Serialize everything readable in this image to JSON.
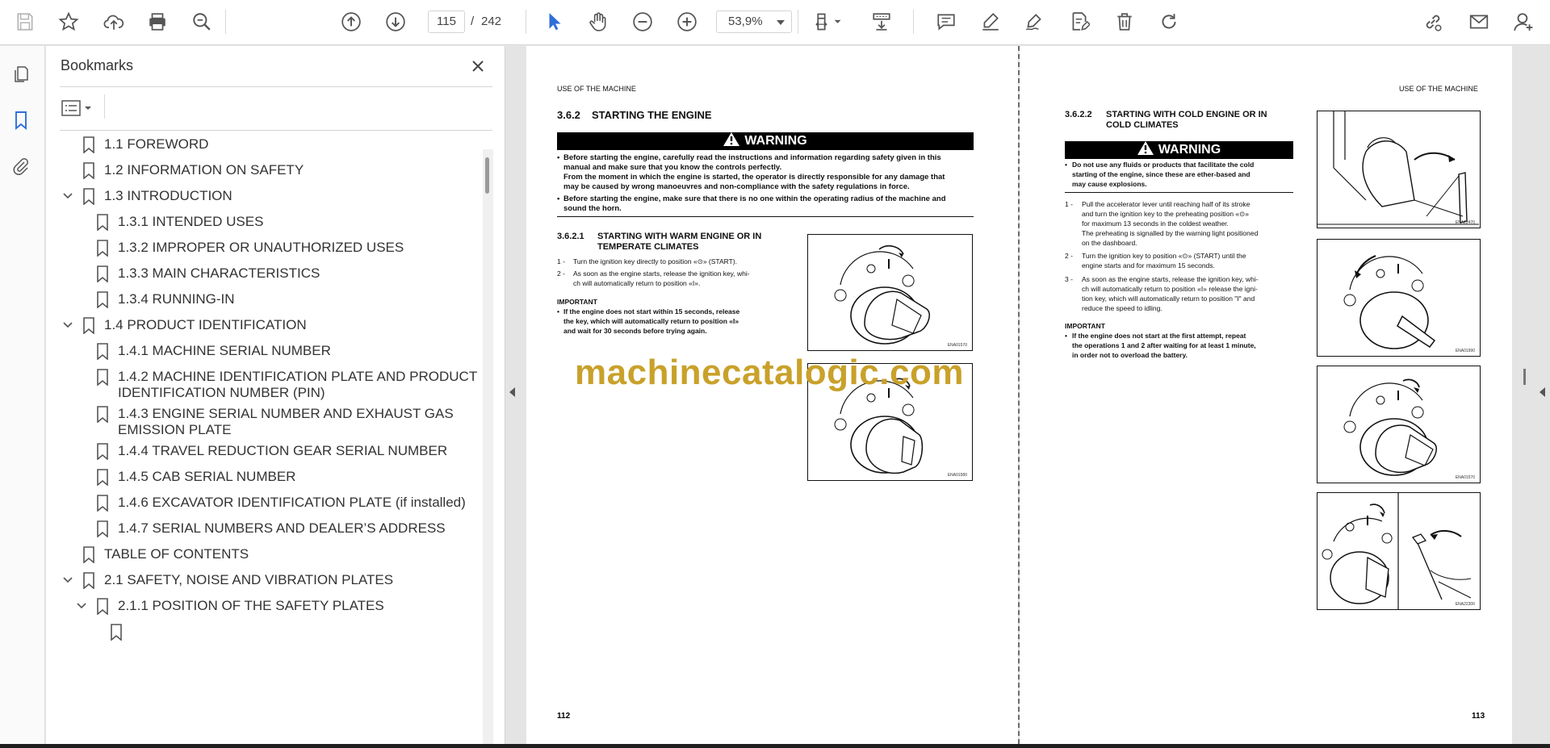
{
  "toolbar": {
    "icons": [
      "save-icon",
      "bookmark-star-icon",
      "upload-icon",
      "print-icon",
      "search-zoom-icon",
      "page-up-icon",
      "page-down-icon",
      "select-cursor-icon",
      "hand-icon",
      "zoom-out-icon",
      "zoom-in-icon",
      "fit-page-icon",
      "scroll-mode-icon",
      "comment-icon",
      "highlight-icon",
      "sign-icon",
      "edit-pdf-icon",
      "delete-icon",
      "rotate-icon",
      "share-link-icon",
      "email-icon",
      "account-icon"
    ],
    "page_current": "115",
    "page_separator": "/",
    "page_total": "242",
    "zoom_value": "53,9%"
  },
  "bookmarks": {
    "title": "Bookmarks",
    "items": [
      {
        "label": "1.1 FOREWORD"
      },
      {
        "label": "1.2 INFORMATION ON SAFETY"
      },
      {
        "label": "1.3 INTRODUCTION"
      },
      {
        "label": "1.3.1 INTENDED USES"
      },
      {
        "label": "1.3.2 IMPROPER OR UNAUTHORIZED USES"
      },
      {
        "label": "1.3.3 MAIN CHARACTERISTICS"
      },
      {
        "label": "1.3.4 RUNNING-IN"
      },
      {
        "label": "1.4 PRODUCT IDENTIFICATION"
      },
      {
        "label": "1.4.1 MACHINE SERIAL NUMBER"
      },
      {
        "label": "1.4.2 MACHINE IDENTIFICATION PLATE AND PRODUCT",
        "label2": "IDENTIFICATION NUMBER (PIN)"
      },
      {
        "label": "1.4.3 ENGINE SERIAL NUMBER AND EXHAUST GAS",
        "label2": "EMISSION PLATE"
      },
      {
        "label": "1.4.4 TRAVEL REDUCTION GEAR SERIAL NUMBER"
      },
      {
        "label": "1.4.5 CAB SERIAL NUMBER"
      },
      {
        "label": "1.4.6 EXCAVATOR IDENTIFICATION PLATE (if installed)"
      },
      {
        "label": "1.4.7 SERIAL NUMBERS AND DEALER’S ADDRESS"
      },
      {
        "label": "TABLE OF CONTENTS"
      },
      {
        "label": "2.1 SAFETY, NOISE AND VIBRATION PLATES"
      },
      {
        "label": "2.1.1 POSITION OF THE SAFETY PLATES"
      }
    ]
  },
  "left_page": {
    "header": "USE OF THE MACHINE",
    "section_num": "3.6.2",
    "section_title": "STARTING THE ENGINE",
    "warning": "WARNING",
    "w1a": "Before starting the engine, carefully read the instructions and information regarding safety given in this",
    "w1b": "manual and make sure that you know the controls perfectly.",
    "w1c": "From the moment in which the engine is started, the operator is directly responsible for any damage that",
    "w1d": "may be caused by wrong manoeuvres and non-compliance with the safety regulations in force.",
    "w2a": "Before starting the engine, make sure that there is no one within the operating radius of the machine and",
    "w2b": "sound the horn.",
    "sub_num": "3.6.2.1",
    "sub_title_a": "STARTING WITH WARM ENGINE OR IN",
    "sub_title_b": "TEMPERATE CLIMATES",
    "s1_num": "1 -",
    "s1": "Turn the ignition key directly to position «⊙» (START).",
    "s2_num": "2 -",
    "s2a": "As soon as the engine starts, release the ignition key, whi-",
    "s2b": "ch will automatically return to position «I».",
    "important": "IMPORTANT",
    "imp_a": "If the engine does not start within 15 seconds, release",
    "imp_b": "the key, which will automatically return to position «I»",
    "imp_c": "and wait for 30 seconds before trying again.",
    "fig1_code": "ENA01570",
    "fig2_code": "ENA01580",
    "page_number": "112"
  },
  "right_page": {
    "header": "USE OF THE MACHINE",
    "sub_num": "3.6.2.2",
    "sub_title_a": "STARTING WITH COLD ENGINE OR IN",
    "sub_title_b": "COLD CLIMATES",
    "warning": "WARNING",
    "w1a": "Do not use any fluids or products that facilitate the cold",
    "w1b": "starting of the engine, since these are ether-based and",
    "w1c": "may cause explosions.",
    "s1_num": "1 -",
    "s1a": "Pull the accelerator lever until reaching half of its stroke",
    "s1b": "and turn the ignition key to the preheating position «⊙»",
    "s1c": "for maximum 13 seconds in the coldest weather.",
    "s1d": "The preheating is signalled by the warning light positioned",
    "s1e": "on the dashboard.",
    "s2_num": "2 -",
    "s2a": "Turn the ignition key to position «⊙» (START) until the",
    "s2b": "engine starts and for maximum 15 seconds.",
    "s3_num": "3 -",
    "s3a": "As soon as the engine starts, release the ignition key, whi-",
    "s3b": "ch will automatically return to position «I» release the igni-",
    "s3c": "tion key, which will automatically return to position \"I\" and",
    "s3d": "reduce the speed to idling.",
    "important": "IMPORTANT",
    "imp_a": "If the engine does not start at the first attempt, repeat",
    "imp_b": "the operations 1 and 2 after waiting for at least 1 minute,",
    "imp_c": "in order not to overload the battery.",
    "fig1_code": "ENA22470",
    "fig2_code": "ENA01990",
    "fig3_code": "ENA01570",
    "fig4_code": "ENA22300",
    "page_number": "113"
  },
  "watermark": "machinecatalogic.com",
  "colors": {
    "watermark": "#c9a12a",
    "accent_blue": "#2f6fd8"
  }
}
